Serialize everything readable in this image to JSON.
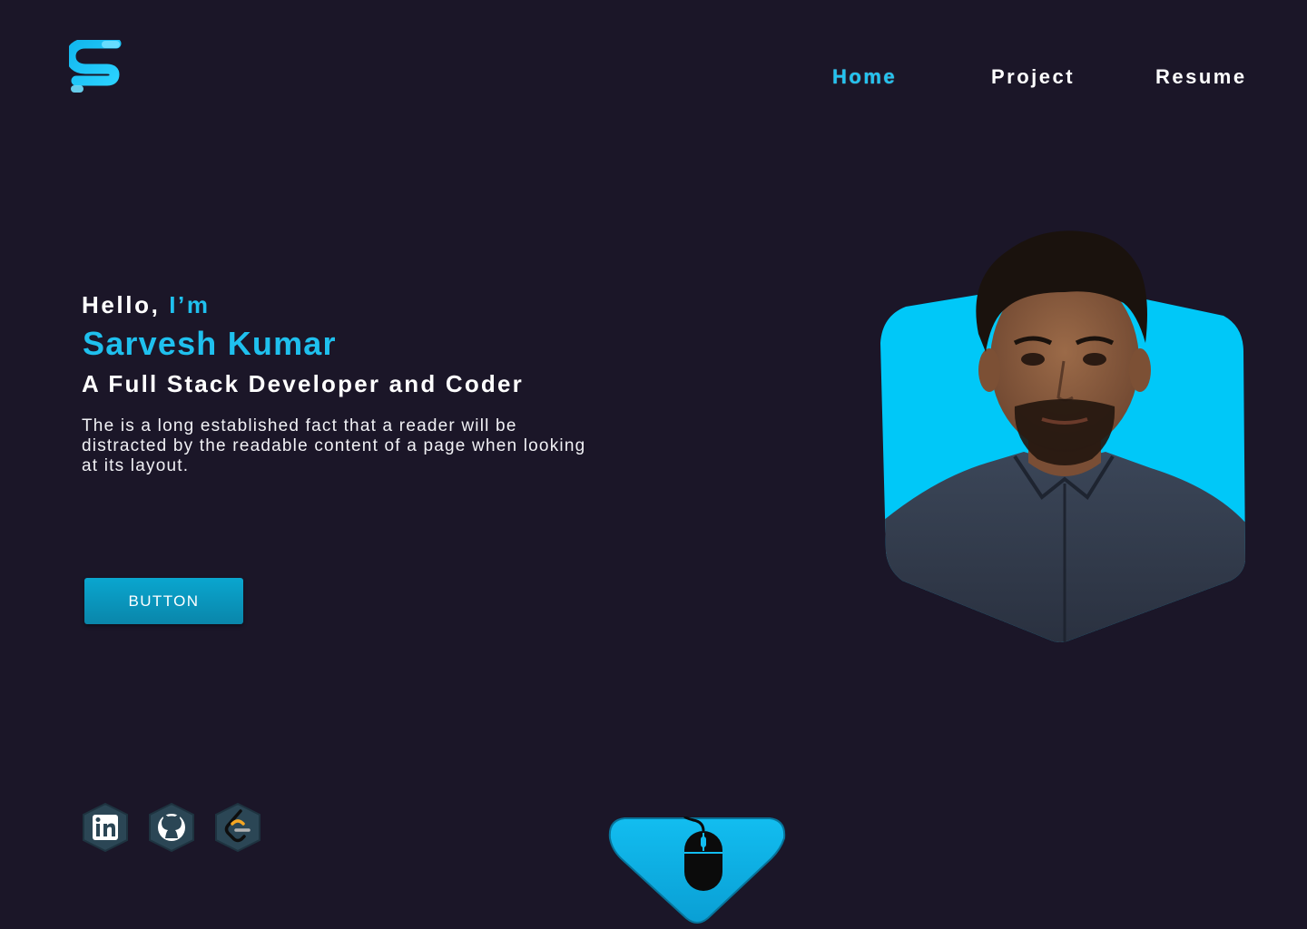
{
  "brand": {
    "logo_icon": "s-logo-icon",
    "accent": "#1fc0ee",
    "background": "#1b1628"
  },
  "nav": {
    "home": "Home",
    "project": "Project",
    "resume": "Resume"
  },
  "hero": {
    "greeting_prefix": "Hello,",
    "greeting_accent": "I’m",
    "name": "Sarvesh Kumar",
    "role": "A Full Stack Developer and Coder",
    "description": "The is a long established fact that a reader will be distracted by the readable content of a page when looking at its layout.",
    "button_label": "BUTTON"
  },
  "portrait": {
    "icon": "profile-photo",
    "backdrop": "#00c8f8"
  },
  "social": [
    {
      "name": "linkedin",
      "icon": "linkedin-icon"
    },
    {
      "name": "github",
      "icon": "github-icon"
    },
    {
      "name": "leetcode",
      "icon": "leetcode-icon"
    }
  ],
  "scroll_indicator": {
    "icon": "mouse-icon"
  }
}
